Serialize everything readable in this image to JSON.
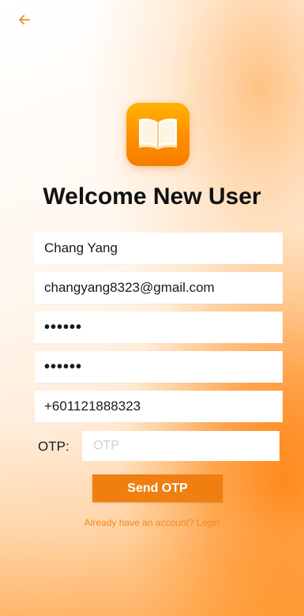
{
  "header": {
    "back_icon": "arrow-left-icon"
  },
  "logo": {
    "icon": "open-book-icon"
  },
  "title": "Welcome New User",
  "form": {
    "name_value": "Chang Yang",
    "email_value": "changyang8323@gmail.com",
    "password_value": "••••••",
    "confirm_password_value": "••••••",
    "phone_value": "+601121888323",
    "otp_label": "OTP:",
    "otp_placeholder": "OTP"
  },
  "actions": {
    "send_otp_label": "Send OTP",
    "login_link_label": "Already have an account? Login"
  },
  "colors": {
    "accent": "#ef7f10",
    "link": "#ef8a1c",
    "title": "#111111"
  }
}
